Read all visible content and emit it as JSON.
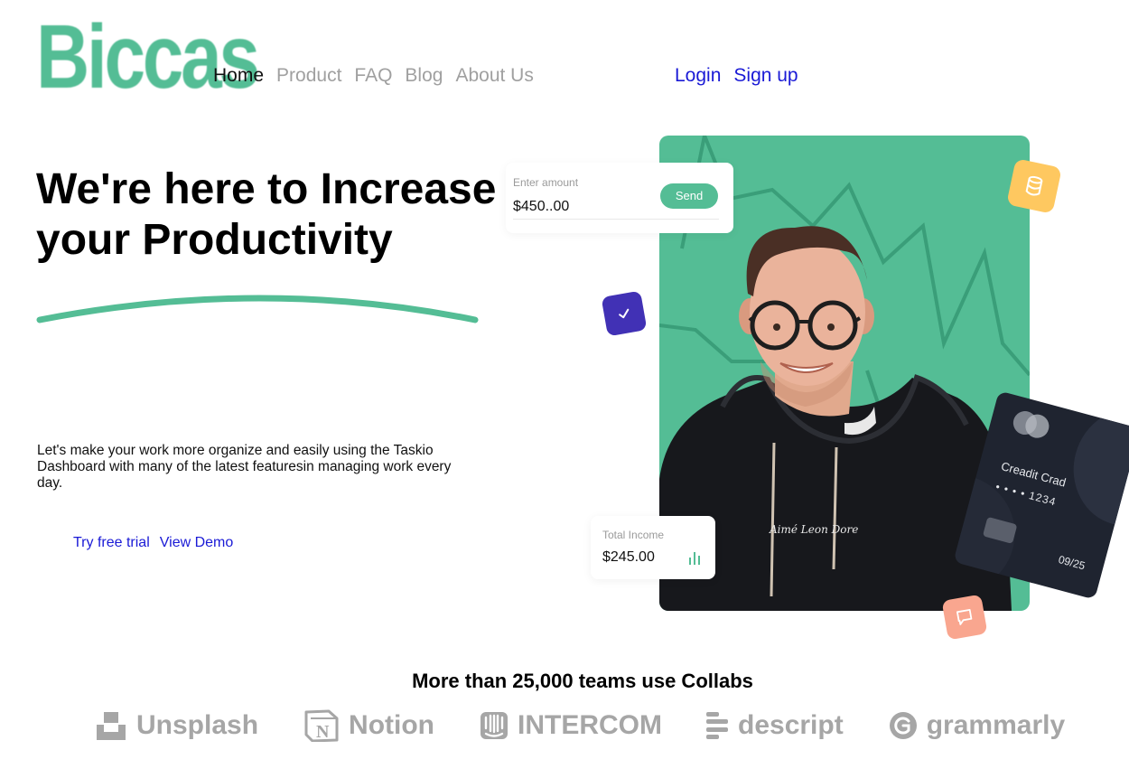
{
  "header": {
    "logo": "Biccas",
    "nav": [
      "Home",
      "Product",
      "FAQ",
      "Blog",
      "About Us"
    ],
    "login": "Login",
    "signup": "Sign up"
  },
  "hero": {
    "title": "We're here to Increase your Productivity",
    "description": "Let's make your work more organize and easily using the Taskio Dashboard with many of the latest featuresin managing work every day.",
    "cta_trial": "Try free trial",
    "cta_demo": "View Demo"
  },
  "amount_card": {
    "label": "Enter amount",
    "value": "$450..00",
    "send_label": "Send"
  },
  "income_card": {
    "label": "Total Income",
    "value": "$245.00"
  },
  "credit_card": {
    "name": "Creadit Crad",
    "number": "• • • •  1234",
    "expiry": "09/25"
  },
  "hoodie_text": "Aimé Leon Dore",
  "teams": {
    "title": "More than 25,000 teams use Collabs",
    "brands": [
      {
        "name": "Unsplash",
        "icon": "unsplash-icon"
      },
      {
        "name": "Notion",
        "icon": "notion-icon"
      },
      {
        "name": "INTERCOM",
        "icon": "intercom-icon"
      },
      {
        "name": "descript",
        "icon": "descript-icon"
      },
      {
        "name": "grammarly",
        "icon": "grammarly-icon"
      }
    ]
  },
  "colors": {
    "brand_green": "#54bd95",
    "link_blue": "#1a1ad6",
    "badge_purple": "#4131b5",
    "badge_yellow": "#fec860",
    "badge_salmon": "#f9a68f",
    "card_dark": "#1f2430"
  }
}
